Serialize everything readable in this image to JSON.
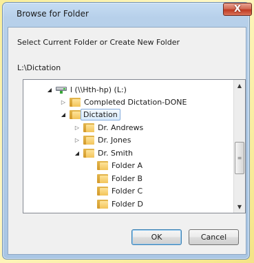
{
  "dialog": {
    "title": "Browse for Folder",
    "close_glyph": "X",
    "description": "Select Current Folder or Create New Folder",
    "current_path": "L:\\Dictation"
  },
  "tree": {
    "items": [
      {
        "label": "l (\\\\Hth-hp) (L:)",
        "icon": "network-drive-icon",
        "expander": "expanded"
      },
      {
        "label": "Completed Dictation-DONE",
        "icon": "folder-icon",
        "expander": "collapsed"
      },
      {
        "label": "Dictation",
        "icon": "folder-icon",
        "expander": "expanded",
        "selected": true
      },
      {
        "label": "Dr. Andrews",
        "icon": "folder-icon",
        "expander": "collapsed"
      },
      {
        "label": "Dr. Jones",
        "icon": "folder-icon",
        "expander": "collapsed"
      },
      {
        "label": "Dr. Smith",
        "icon": "folder-icon",
        "expander": "expanded"
      },
      {
        "label": "Folder A",
        "icon": "folder-icon",
        "expander": "none"
      },
      {
        "label": "Folder B",
        "icon": "folder-icon",
        "expander": "none"
      },
      {
        "label": "Folder C",
        "icon": "folder-icon",
        "expander": "none"
      },
      {
        "label": "Folder D",
        "icon": "folder-icon",
        "expander": "none"
      }
    ]
  },
  "buttons": {
    "ok": "OK",
    "cancel": "Cancel"
  },
  "colors": {
    "background": "#fdf4a8",
    "selection": "#d8ebfc",
    "close_button": "#c7472d"
  }
}
